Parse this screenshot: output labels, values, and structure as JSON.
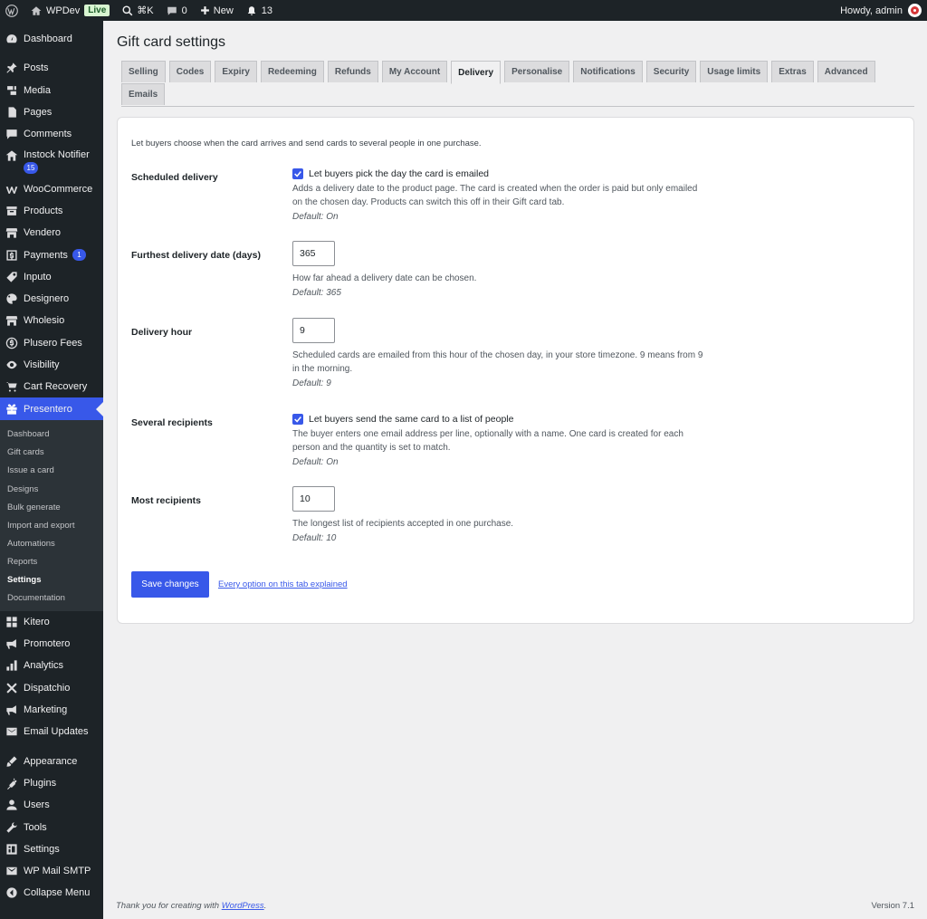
{
  "adminbar": {
    "site_name": "WPDev",
    "live_badge": "Live",
    "search_shortcut": "⌘K",
    "comments_count": "0",
    "new_label": "New",
    "notifications_count": "13",
    "howdy": "Howdy, admin"
  },
  "sidebar": {
    "items": [
      {
        "label": "Dashboard",
        "icon": "dashboard-icon"
      },
      {
        "label": "Posts",
        "icon": "pin-icon"
      },
      {
        "label": "Media",
        "icon": "media-icon"
      },
      {
        "label": "Pages",
        "icon": "page-icon"
      },
      {
        "label": "Comments",
        "icon": "comment-icon"
      },
      {
        "label": "Instock Notifier",
        "icon": "house-icon",
        "badge": "15"
      },
      {
        "label": "WooCommerce",
        "icon": "woo-icon"
      },
      {
        "label": "Products",
        "icon": "archive-icon"
      },
      {
        "label": "Vendero",
        "icon": "store-icon"
      },
      {
        "label": "Payments",
        "icon": "dollar-box-icon",
        "badge": "1"
      },
      {
        "label": "Inputo",
        "icon": "tag-icon"
      },
      {
        "label": "Designero",
        "icon": "palette-icon"
      },
      {
        "label": "Wholesio",
        "icon": "store-icon"
      },
      {
        "label": "Plusero Fees",
        "icon": "dollar-circle-icon"
      },
      {
        "label": "Visibility",
        "icon": "eye-icon"
      },
      {
        "label": "Cart Recovery",
        "icon": "cart-icon"
      },
      {
        "label": "Presentero",
        "icon": "gift-icon"
      }
    ],
    "submenu": [
      "Dashboard",
      "Gift cards",
      "Issue a card",
      "Designs",
      "Bulk generate",
      "Import and export",
      "Automations",
      "Reports",
      "Settings",
      "Documentation"
    ],
    "submenu_current": "Settings",
    "items_after": [
      {
        "label": "Kitero",
        "icon": "grid-icon"
      },
      {
        "label": "Promotero",
        "icon": "megaphone-icon"
      },
      {
        "label": "Analytics",
        "icon": "bar-chart-icon"
      },
      {
        "label": "Dispatchio",
        "icon": "cross-icon"
      },
      {
        "label": "Marketing",
        "icon": "megaphone-icon"
      },
      {
        "label": "Email Updates",
        "icon": "email-icon"
      },
      {
        "label": "Appearance",
        "icon": "brush-icon"
      },
      {
        "label": "Plugins",
        "icon": "plug-icon"
      },
      {
        "label": "Users",
        "icon": "user-icon"
      },
      {
        "label": "Tools",
        "icon": "wrench-icon"
      },
      {
        "label": "Settings",
        "icon": "settings-icon"
      },
      {
        "label": "WP Mail SMTP",
        "icon": "mail-icon"
      },
      {
        "label": "Collapse Menu",
        "icon": "collapse-icon"
      }
    ]
  },
  "page": {
    "title": "Gift card settings",
    "tabs": [
      "Selling",
      "Codes",
      "Expiry",
      "Redeeming",
      "Refunds",
      "My Account",
      "Delivery",
      "Personalise",
      "Notifications",
      "Security",
      "Usage limits",
      "Extras",
      "Advanced",
      "Emails"
    ],
    "active_tab": "Delivery"
  },
  "settings": {
    "intro": "Let buyers choose when the card arrives and send cards to several people in one purchase.",
    "scheduled": {
      "label": "Scheduled delivery",
      "checkbox_label": "Let buyers pick the day the card is emailed",
      "checked": true,
      "desc": "Adds a delivery date to the product page. The card is created when the order is paid but only emailed on the chosen day. Products can switch this off in their Gift card tab.",
      "default": "Default: On"
    },
    "furthest": {
      "label": "Furthest delivery date (days)",
      "value": "365",
      "desc": "How far ahead a delivery date can be chosen.",
      "default": "Default: 365"
    },
    "hour": {
      "label": "Delivery hour",
      "value": "9",
      "desc": "Scheduled cards are emailed from this hour of the chosen day, in your store timezone. 9 means from 9 in the morning.",
      "default": "Default: 9"
    },
    "several": {
      "label": "Several recipients",
      "checkbox_label": "Let buyers send the same card to a list of people",
      "checked": true,
      "desc": "The buyer enters one email address per line, optionally with a name. One card is created for each person and the quantity is set to match.",
      "default": "Default: On"
    },
    "most": {
      "label": "Most recipients",
      "value": "10",
      "desc": "The longest list of recipients accepted in one purchase.",
      "default": "Default: 10"
    },
    "save_label": "Save changes",
    "explain_link": "Every option on this tab explained"
  },
  "footer": {
    "thanks_prefix": "Thank you for creating with ",
    "thanks_link": "WordPress",
    "thanks_suffix": ".",
    "version": "Version 7.1"
  },
  "colors": {
    "accent": "#3858e9",
    "admin_dark": "#1d2327",
    "background": "#f0f0f1"
  }
}
